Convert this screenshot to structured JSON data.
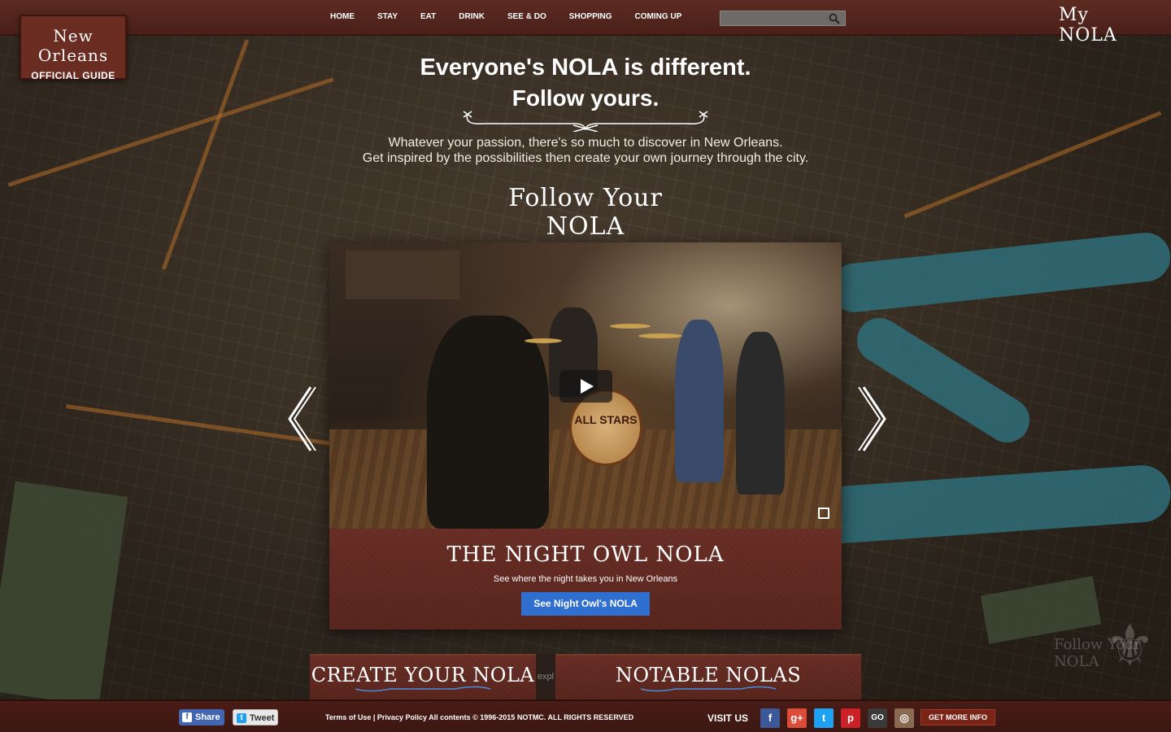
{
  "header": {
    "logo": {
      "line1": "New Orleans",
      "line2": "OFFICIAL GUIDE"
    },
    "nav": [
      {
        "label": "HOME"
      },
      {
        "label": "STAY"
      },
      {
        "label": "EAT"
      },
      {
        "label": "DRINK"
      },
      {
        "label": "SEE & DO"
      },
      {
        "label": "SHOPPING"
      },
      {
        "label": "COMING UP"
      }
    ],
    "search": {
      "value": "",
      "placeholder": "",
      "icon": "search-icon"
    },
    "my_nola": "My NOLA"
  },
  "hero": {
    "headline": "Everyone's NOLA is different.",
    "headline2": "Follow yours.",
    "sub_line1": "Whatever your passion, there's so much to discover in New Orleans.",
    "sub_line2": "Get inspired by the possibilities then create your own journey through the city.",
    "follow_logo": "Follow Your NOLA"
  },
  "card": {
    "drum_text": "ALL STARS",
    "title": "THE NIGHT OWL NOLA",
    "subtitle": "See where the night takes you in New Orleans",
    "button": "See Night Owl's NOLA"
  },
  "tabs": {
    "create": "CREATE YOUR NOLA",
    "notable": "NOTABLE NOLAS",
    "gap_text": "expl"
  },
  "watermark": {
    "text": "Follow Your NOLA"
  },
  "footer": {
    "share": "Share",
    "tweet": "Tweet",
    "terms": "Terms of Use",
    "separator": "|",
    "privacy": "Privacy Policy",
    "copyright": "All contents © 1996-2015 NOTMC. ALL RIGHTS RESERVED",
    "visit_us": "VISIT US",
    "social": [
      {
        "name": "facebook-icon",
        "glyph": "f",
        "color": "#3b5998"
      },
      {
        "name": "google-plus-icon",
        "glyph": "g+",
        "color": "#dd4b39"
      },
      {
        "name": "twitter-icon",
        "glyph": "t",
        "color": "#1da1f2"
      },
      {
        "name": "pinterest-icon",
        "glyph": "p",
        "color": "#cb2027"
      },
      {
        "name": "go-nola-icon",
        "glyph": "GO",
        "color": "#3a3a3a"
      },
      {
        "name": "instagram-icon",
        "glyph": "◎",
        "color": "#8a6a52"
      }
    ],
    "get_more_info": "GET MORE INFO"
  },
  "colors": {
    "topbar": "#5c2b22",
    "card_button": "#2f6fd0",
    "river": "#2f6e7a"
  }
}
